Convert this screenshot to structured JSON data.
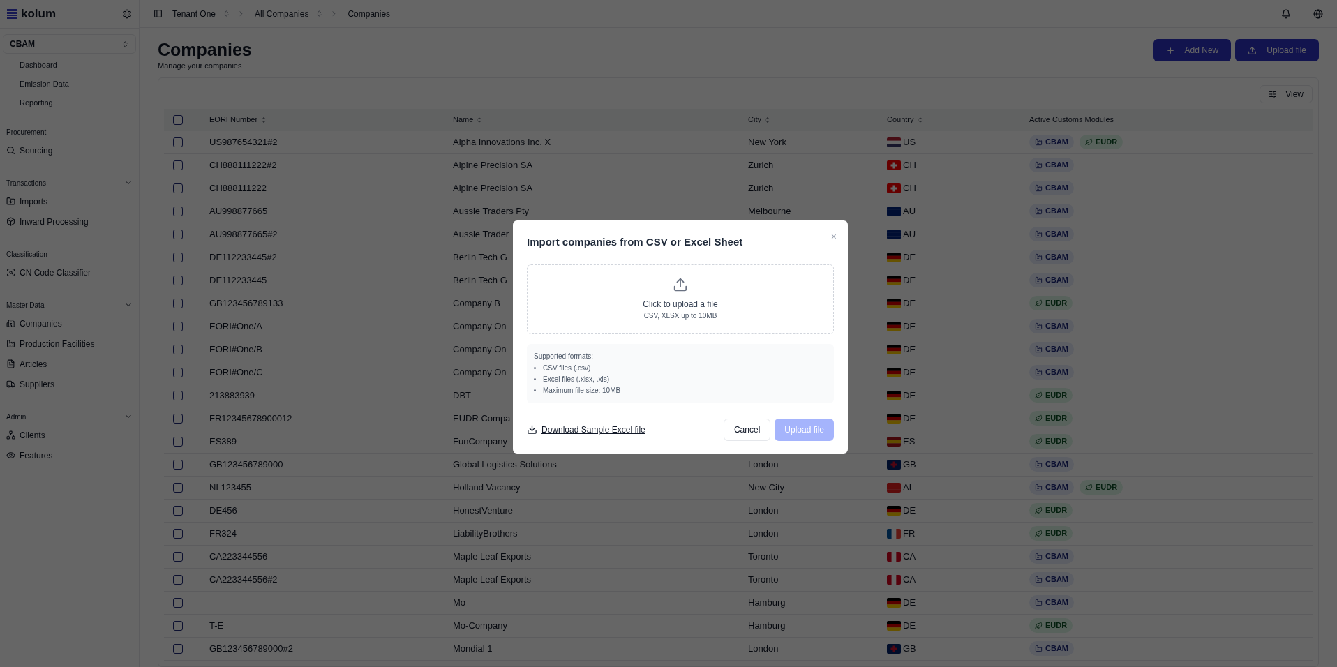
{
  "sidebar": {
    "logo": "kolum",
    "module_selector": "CBAM",
    "module_items": [
      {
        "label": "Dashboard"
      },
      {
        "label": "Emission Data"
      },
      {
        "label": "Reporting"
      }
    ],
    "sections": [
      {
        "title": "Procurement",
        "collapsible": false,
        "expanded": true,
        "items": [
          {
            "label": "Sourcing",
            "kind": "search"
          }
        ]
      },
      {
        "title": "Transactions",
        "collapsible": true,
        "expanded": true,
        "items": [
          {
            "label": "Imports",
            "kind": "folder"
          },
          {
            "label": "Inward Processing",
            "kind": "box"
          }
        ]
      },
      {
        "title": "Classification",
        "collapsible": false,
        "expanded": true,
        "items": [
          {
            "label": "CN Code Classifier",
            "kind": "scan"
          }
        ]
      },
      {
        "title": "Master Data",
        "collapsible": true,
        "expanded": true,
        "items": [
          {
            "label": "Companies",
            "kind": "building"
          },
          {
            "label": "Production Facilities",
            "kind": "factory"
          },
          {
            "label": "Articles",
            "kind": "file"
          },
          {
            "label": "Suppliers",
            "kind": "truck"
          }
        ]
      },
      {
        "title": "Admin",
        "collapsible": true,
        "expanded": true,
        "items": [
          {
            "label": "Clients",
            "kind": "network"
          },
          {
            "label": "Features",
            "kind": "eye"
          }
        ]
      }
    ]
  },
  "breadcrumbs": [
    {
      "label": "Tenant One",
      "switcher": true
    },
    {
      "label": "All Companies",
      "switcher": true
    },
    {
      "label": "Companies",
      "switcher": false
    }
  ],
  "page": {
    "title": "Companies",
    "subtitle": "Manage your companies",
    "actions": [
      {
        "label": "Add New",
        "kind": "add"
      },
      {
        "label": "Upload file",
        "kind": "upload"
      }
    ]
  },
  "view_button": "View",
  "table": {
    "select_all_checked": false,
    "columns": [
      {
        "label": "EORI Number",
        "sortable": true
      },
      {
        "label": "Name",
        "sortable": true
      },
      {
        "label": "City",
        "sortable": true
      },
      {
        "label": "Country",
        "sortable": true
      },
      {
        "label": "Active Customs Modules",
        "sortable": false
      }
    ],
    "rows": [
      {
        "checked": false,
        "eori": "US987654321#2",
        "name": "Alpha Innovations Inc. X",
        "city": "New York",
        "country": {
          "code": "US",
          "kind": "us"
        },
        "modules": [
          {
            "label": "CBAM",
            "kind": "cbam"
          },
          {
            "label": "EUDR",
            "kind": "eudr"
          }
        ]
      },
      {
        "checked": false,
        "eori": "CH888111222#2",
        "name": "Alpine Precision SA",
        "city": "Zurich",
        "country": {
          "code": "CH",
          "kind": "ch"
        },
        "modules": [
          {
            "label": "CBAM",
            "kind": "cbam"
          }
        ]
      },
      {
        "checked": false,
        "eori": "CH888111222",
        "name": "Alpine Precision SA",
        "city": "Zurich",
        "country": {
          "code": "CH",
          "kind": "ch"
        },
        "modules": [
          {
            "label": "CBAM",
            "kind": "cbam"
          }
        ]
      },
      {
        "checked": false,
        "eori": "AU998877665",
        "name": "Aussie Traders Pty",
        "city": "Melbourne",
        "country": {
          "code": "AU",
          "kind": "au"
        },
        "modules": [
          {
            "label": "CBAM",
            "kind": "cbam"
          }
        ]
      },
      {
        "checked": false,
        "eori": "AU998877665#2",
        "name": "Aussie Trader",
        "country": {
          "code": "AU",
          "kind": "au"
        },
        "modules": [
          {
            "label": "CBAM",
            "kind": "cbam"
          }
        ]
      },
      {
        "checked": false,
        "eori": "DE112233445#2",
        "name": "Berlin Tech G",
        "country": {
          "code": "DE",
          "kind": "de"
        },
        "modules": [
          {
            "label": "CBAM",
            "kind": "cbam"
          }
        ]
      },
      {
        "checked": false,
        "eori": "DE112233445",
        "name": "Berlin Tech G",
        "country": {
          "code": "DE",
          "kind": "de"
        },
        "modules": [
          {
            "label": "CBAM",
            "kind": "cbam"
          }
        ]
      },
      {
        "checked": false,
        "eori": "GB123456789133",
        "name": "Company B",
        "country": {
          "code": "DE",
          "kind": "de"
        },
        "modules": [
          {
            "label": "EUDR",
            "kind": "eudr"
          }
        ]
      },
      {
        "checked": false,
        "eori": "EORI#One/A",
        "name": "Company On",
        "country": {
          "code": "DE",
          "kind": "de"
        },
        "modules": [
          {
            "label": "CBAM",
            "kind": "cbam"
          }
        ]
      },
      {
        "checked": false,
        "eori": "EORI#One/B",
        "name": "Company On",
        "country": {
          "code": "DE",
          "kind": "de"
        },
        "modules": [
          {
            "label": "CBAM",
            "kind": "cbam"
          }
        ]
      },
      {
        "checked": false,
        "eori": "EORI#One/C",
        "name": "Company On",
        "country": {
          "code": "DE",
          "kind": "de"
        },
        "modules": [
          {
            "label": "CBAM",
            "kind": "cbam"
          }
        ]
      },
      {
        "checked": false,
        "eori": "213883939",
        "name": "DBT",
        "country": {
          "code": "DE",
          "kind": "de"
        },
        "modules": [
          {
            "label": "EUDR",
            "kind": "eudr"
          }
        ]
      },
      {
        "checked": false,
        "eori": "FR12345678900012",
        "name": "EUDR Compa",
        "country": {
          "code": "DE",
          "kind": "de"
        },
        "modules": [
          {
            "label": "EUDR",
            "kind": "eudr"
          }
        ]
      },
      {
        "checked": false,
        "eori": "ES389",
        "name": "FunCompany",
        "country": {
          "code": "ES",
          "kind": "es"
        },
        "modules": [
          {
            "label": "EUDR",
            "kind": "eudr"
          }
        ]
      },
      {
        "checked": false,
        "eori": "GB123456789000",
        "name": "Global Logistics Solutions",
        "city": "London",
        "country": {
          "code": "GB",
          "kind": "gb"
        },
        "modules": [
          {
            "label": "CBAM",
            "kind": "cbam"
          }
        ]
      },
      {
        "checked": false,
        "eori": "NL123455",
        "name": "Holland Vacancy",
        "city": "New City",
        "country": {
          "code": "AL",
          "kind": "al"
        },
        "modules": [
          {
            "label": "CBAM",
            "kind": "cbam"
          },
          {
            "label": "EUDR",
            "kind": "eudr"
          }
        ]
      },
      {
        "checked": false,
        "eori": "DE456",
        "name": "HonestVenture",
        "city": "London",
        "country": {
          "code": "DE",
          "kind": "de"
        },
        "modules": [
          {
            "label": "EUDR",
            "kind": "eudr"
          }
        ]
      },
      {
        "checked": false,
        "eori": "FR324",
        "name": "LiabilityBrothers",
        "city": "London",
        "country": {
          "code": "FR",
          "kind": "fr"
        },
        "modules": [
          {
            "label": "EUDR",
            "kind": "eudr"
          }
        ]
      },
      {
        "checked": false,
        "eori": "CA223344556",
        "name": "Maple Leaf Exports",
        "city": "Toronto",
        "country": {
          "code": "CA",
          "kind": "ca"
        },
        "modules": [
          {
            "label": "CBAM",
            "kind": "cbam"
          }
        ]
      },
      {
        "checked": false,
        "eori": "CA223344556#2",
        "name": "Maple Leaf Exports",
        "city": "Toronto",
        "country": {
          "code": "CA",
          "kind": "ca"
        },
        "modules": [
          {
            "label": "CBAM",
            "kind": "cbam"
          }
        ]
      },
      {
        "checked": false,
        "name": "Mo",
        "city": "Hamburg",
        "country": {
          "code": "DE",
          "kind": "de"
        },
        "modules": [
          {
            "label": "CBAM",
            "kind": "cbam"
          }
        ]
      },
      {
        "checked": false,
        "eori": "T-E",
        "name": "Mo-Company",
        "city": "Hamburg",
        "country": {
          "code": "DE",
          "kind": "de"
        },
        "modules": [
          {
            "label": "EUDR",
            "kind": "eudr"
          }
        ]
      },
      {
        "checked": false,
        "eori": "GB123456789000#2",
        "name": "Mondial 1",
        "city": "London",
        "country": {
          "code": "GB",
          "kind": "gb"
        },
        "modules": [
          {
            "label": "CBAM",
            "kind": "cbam"
          }
        ]
      }
    ]
  },
  "dialog": {
    "title": "Import companies from CSV or Excel Sheet",
    "close": "×",
    "dropzone": {
      "title": "Click to upload a file",
      "hint": "CSV, XLSX up to 10MB"
    },
    "formats": {
      "title": "Supported formats:",
      "items": [
        "CSV files (.csv)",
        "Excel files (.xlsx, .xls)",
        "Maximum file size: 10MB"
      ]
    },
    "download_link": "Download Sample Excel file",
    "cancel": "Cancel",
    "submit": {
      "label": "Upload file",
      "disabled": true
    }
  }
}
